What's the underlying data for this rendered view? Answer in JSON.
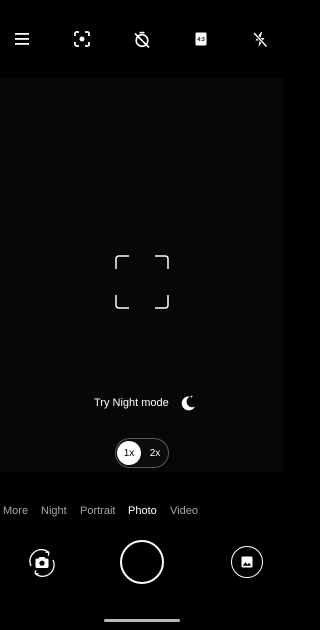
{
  "top_controls": [
    {
      "icon": "menu-icon"
    },
    {
      "icon": "focus-scan-icon"
    },
    {
      "icon": "timer-off-icon"
    },
    {
      "icon": "aspect-ratio-icon",
      "label": "4:3"
    },
    {
      "icon": "flash-off-icon"
    }
  ],
  "night_hint": {
    "text": "Try Night mode",
    "icon": "moon-icon"
  },
  "zoom": {
    "options": [
      "1x",
      "2x"
    ],
    "selected": "1x"
  },
  "modes": [
    "More",
    "Night",
    "Portrait",
    "Photo",
    "Video"
  ],
  "active_mode": "Photo",
  "bottom_controls": {
    "left": "camera-flip-icon",
    "center": "shutter",
    "right": "gallery-icon"
  },
  "colors": {
    "background": "#000000",
    "viewfinder": "#080607",
    "inactive_text": "#a6a6a6",
    "active_text": "#ffffff"
  }
}
